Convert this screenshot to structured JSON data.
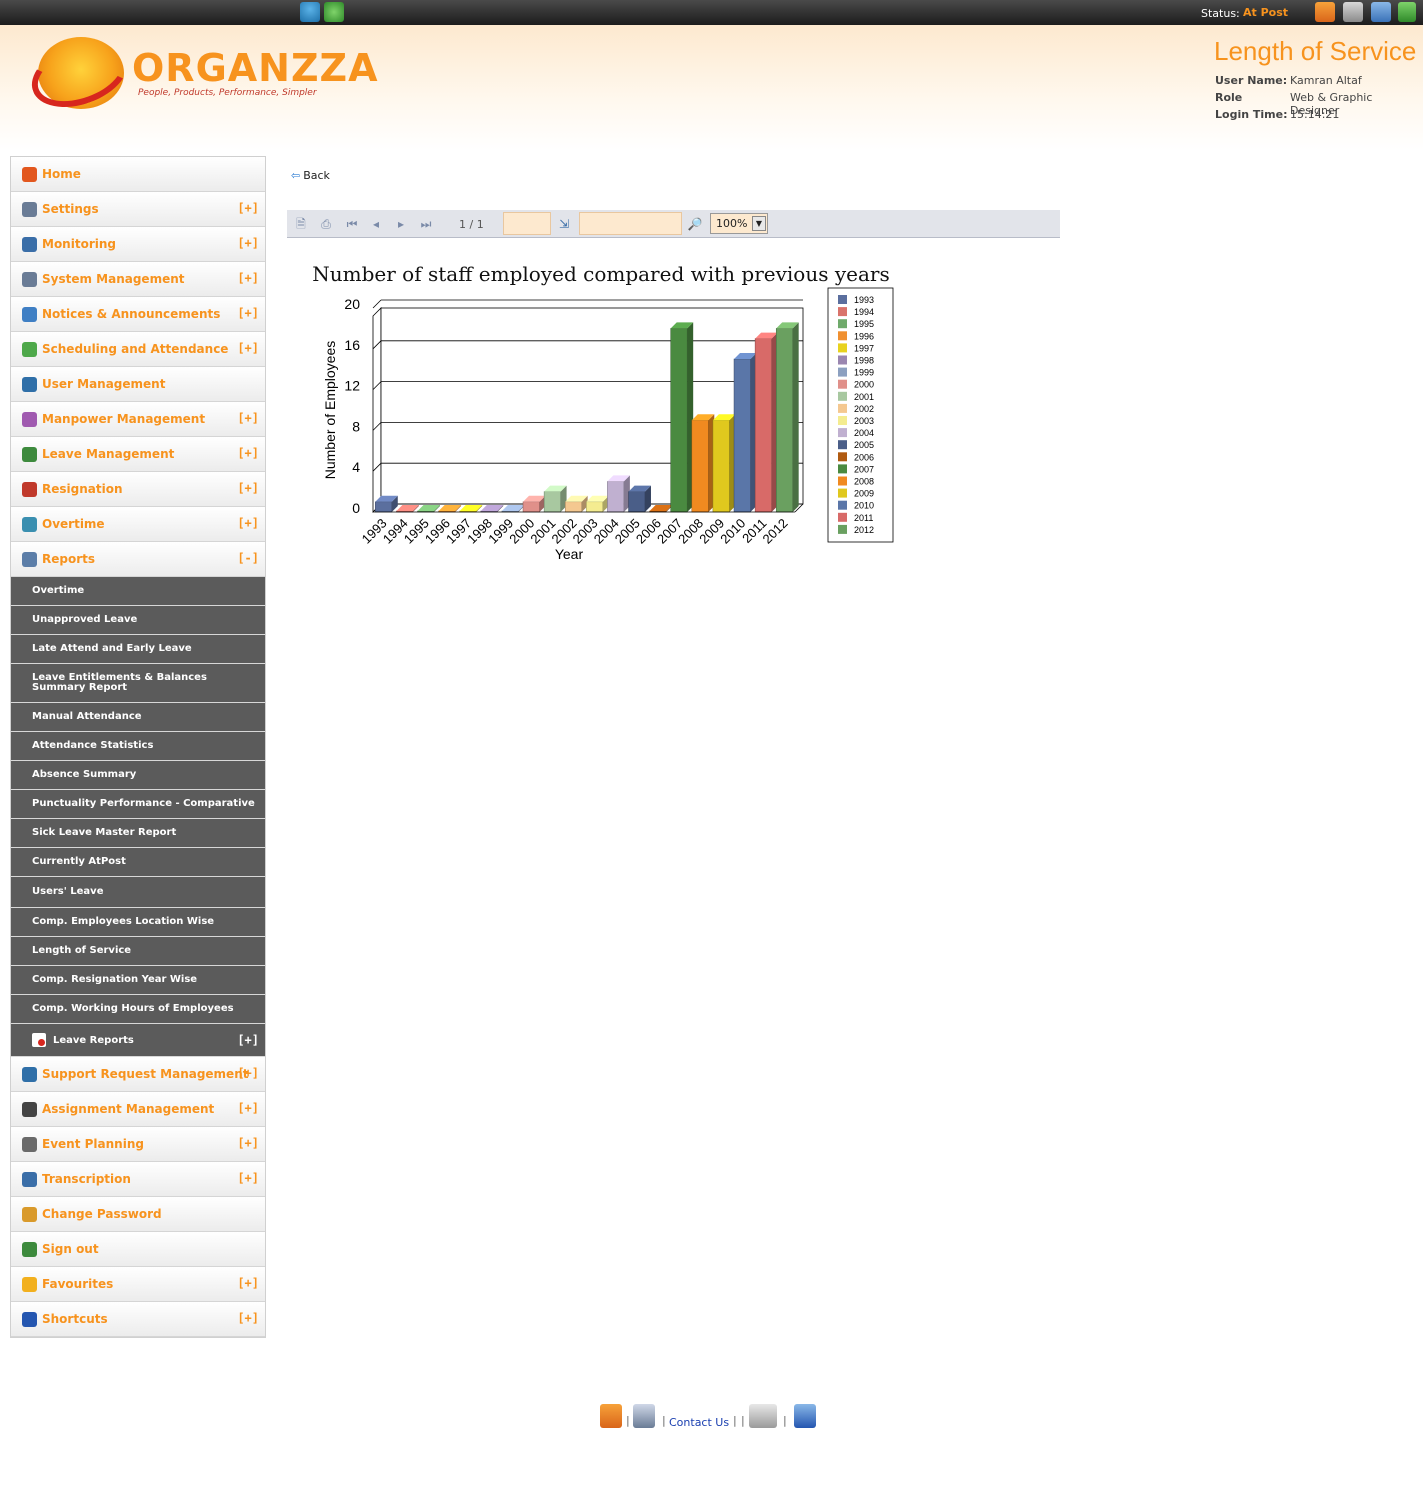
{
  "topbar": {
    "status_label": "Status:",
    "status_value": "At Post",
    "icons": [
      "user-add-icon",
      "home-icon",
      "inbox-icon",
      "phone-icon",
      "exit-icon"
    ]
  },
  "header": {
    "logo_text": "ORGANZZA",
    "tagline": "People, Products, Performance, Simpler",
    "page_title": "Length of Service",
    "user_name_label": "User Name:",
    "user_name": "Kamran Altaf",
    "role_label": "Role",
    "role": "Web & Graphic Designer",
    "login_time_label": "Login Time:",
    "login_time": "15:14:21"
  },
  "sidebar": {
    "items": [
      {
        "label": "Home",
        "toggle": "",
        "icon": "home-icon",
        "color": "#e2571e"
      },
      {
        "label": "Settings",
        "toggle": "[+]",
        "icon": "gear-icon",
        "color": "#6a7c96"
      },
      {
        "label": "Monitoring",
        "toggle": "[+]",
        "icon": "magnifier-icon",
        "color": "#3a6ea8"
      },
      {
        "label": "System Management",
        "toggle": "[+]",
        "icon": "gear-icon",
        "color": "#6a7c96"
      },
      {
        "label": "Notices & Announcements",
        "toggle": "[+]",
        "icon": "megaphone-icon",
        "color": "#3f7fc4"
      },
      {
        "label": "Scheduling and Attendance",
        "toggle": "[+]",
        "icon": "calendar-icon",
        "color": "#4ea84a"
      },
      {
        "label": "User Management",
        "toggle": "",
        "icon": "users-icon",
        "color": "#2f6fa8"
      },
      {
        "label": "Manpower Management",
        "toggle": "[+]",
        "icon": "person-icon",
        "color": "#a05ab0"
      },
      {
        "label": "Leave Management",
        "toggle": "[+]",
        "icon": "walking-person-icon",
        "color": "#3d8a3d"
      },
      {
        "label": "Resignation",
        "toggle": "[+]",
        "icon": "resignation-icon",
        "color": "#c0392b"
      },
      {
        "label": "Overtime",
        "toggle": "[+]",
        "icon": "clock-icon",
        "color": "#3a8fb0"
      },
      {
        "label": "Reports",
        "toggle": "[-]",
        "icon": "report-icon",
        "color": "#5c7ea8"
      }
    ],
    "reports_subitems": [
      "Overtime",
      "Unapproved Leave",
      "Late Attend and Early Leave",
      "Leave Entitlements & Balances Summary Report",
      "Manual Attendance",
      "Attendance Statistics",
      "Absence Summary",
      "Punctuality Performance - Comparative",
      "Sick Leave Master Report",
      "Currently AtPost",
      "Users' Leave",
      "Comp. Employees Location Wise",
      "Length of Service",
      "Comp. Resignation Year Wise",
      "Comp. Working Hours of Employees"
    ],
    "leave_reports": {
      "label": "Leave Reports",
      "toggle": "[+]"
    },
    "lower_items": [
      {
        "label": "Support Request Management",
        "toggle": "[+]",
        "icon": "support-person-icon",
        "color": "#2f6fa8"
      },
      {
        "label": "Assignment Management",
        "toggle": "[+]",
        "icon": "headset-icon",
        "color": "#444444"
      },
      {
        "label": "Event Planning",
        "toggle": "[+]",
        "icon": "calendar-icon",
        "color": "#6a6a6a"
      },
      {
        "label": "Transcription",
        "toggle": "[+]",
        "icon": "document-icon",
        "color": "#3a6ea8"
      },
      {
        "label": "Change Password",
        "toggle": "",
        "icon": "key-user-icon",
        "color": "#d99a2b"
      },
      {
        "label": "Sign out",
        "toggle": "",
        "icon": "sign-out-icon",
        "color": "#3d8a3d"
      },
      {
        "label": "Favourites",
        "toggle": "[+]",
        "icon": "star-icon",
        "color": "#f2b01e"
      },
      {
        "label": "Shortcuts",
        "toggle": "[+]",
        "icon": "shortcut-icon",
        "color": "#2456b0"
      }
    ]
  },
  "main": {
    "back_label": "Back",
    "page_count": "1 / 1",
    "zoom": "100%"
  },
  "chart_data": {
    "type": "bar",
    "title": "Number of staff employed compared with previous years",
    "xlabel": "Year",
    "ylabel": "Number of Employees",
    "ylim": [
      0,
      20
    ],
    "yticks": [
      0,
      4,
      8,
      12,
      16,
      20
    ],
    "grid": true,
    "legend_position": "right",
    "categories": [
      "1993",
      "1994",
      "1995",
      "1996",
      "1997",
      "1998",
      "1999",
      "2000",
      "2001",
      "2002",
      "2003",
      "2004",
      "2005",
      "2006",
      "2007",
      "2008",
      "2009",
      "2010",
      "2011",
      "2012"
    ],
    "values": [
      1,
      0,
      0,
      0,
      0,
      0,
      0,
      1,
      2,
      1,
      1,
      3,
      2,
      0,
      18,
      9,
      9,
      15,
      17,
      18
    ],
    "colors": [
      "#5b6f9e",
      "#d9736b",
      "#6faa6b",
      "#f09030",
      "#e8d21e",
      "#9a86b0",
      "#8ca0c0",
      "#e0908a",
      "#a8c8a0",
      "#f4c890",
      "#f4ec90",
      "#c0b0d0",
      "#4a5e88",
      "#b05a10",
      "#4a8a40",
      "#f08a20",
      "#e0c81e",
      "#5a76a8",
      "#d86a68",
      "#6aa060"
    ]
  },
  "footer": {
    "contact_label": "Contact Us",
    "separator": "|",
    "icons": [
      "home-icon",
      "directory-icon",
      "help-icon",
      "tools-icon"
    ]
  }
}
